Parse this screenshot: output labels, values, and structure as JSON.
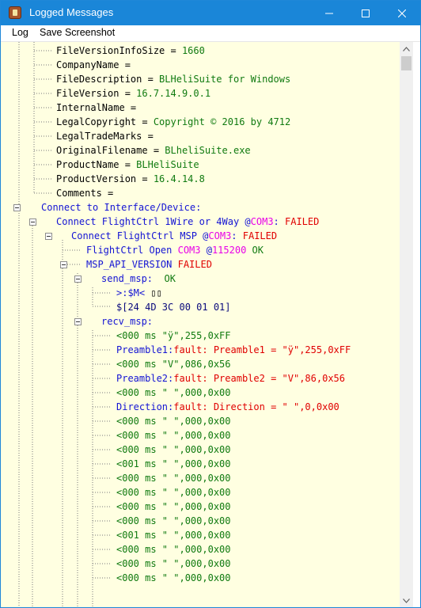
{
  "window": {
    "title": "Logged Messages"
  },
  "icons": {
    "app": "app-icon",
    "minimize": "minimize-icon",
    "maximize": "maximize-icon",
    "close": "close-icon",
    "expand": "expander-minus-icon"
  },
  "menu": {
    "log": "Log",
    "save": "Save Screenshot"
  },
  "colors": {
    "titlebar": "#1a86d8",
    "background": "#ffffe1",
    "key_text": "#000000",
    "value_text": "#107a10",
    "heading_text": "#1414d4",
    "failed_text": "#e00000",
    "port_text": "#e800e8"
  },
  "log": {
    "l0": [
      "FileVersionInfoSize = ",
      "1660"
    ],
    "l1": [
      "CompanyName ="
    ],
    "l2": [
      "FileDescription = ",
      "BLHeliSuite for Windows"
    ],
    "l3": [
      "FileVersion = ",
      "16.7.14.9.0.1"
    ],
    "l4": [
      "InternalName ="
    ],
    "l5": [
      "LegalCopyright = ",
      "Copyright © 2016 by 4712"
    ],
    "l6": [
      "LegalTradeMarks ="
    ],
    "l7": [
      "OriginalFilename = ",
      "BLheliSuite.exe"
    ],
    "l8": [
      "ProductName = ",
      "BLHeliSuite"
    ],
    "l9": [
      "ProductVersion = ",
      "16.4.14.8"
    ],
    "l10": [
      "Comments ="
    ],
    "l11": [
      "Connect to Interface/Device:"
    ],
    "l12": [
      "Connect FlightCtrl 1Wire or 4Way @",
      "COM3",
      ": ",
      "FAILED"
    ],
    "l13": [
      "Connect FlightCtrl MSP @",
      "COM3",
      ": ",
      "FAILED"
    ],
    "l14": [
      "FlightCtrl Open ",
      "COM3",
      " @",
      "115200",
      " OK"
    ],
    "l15": [
      "MSP_API_VERSION ",
      "FAILED"
    ],
    "l16": [
      "send_msp:  ",
      "OK"
    ],
    "l17": [
      ">:$M<",
      " ▯▯"
    ],
    "l18": [
      "$[24 4D 3C 00 01 01]"
    ],
    "l19": [
      "recv_msp:"
    ],
    "l20": [
      "<000 ms \"ÿ\",255,0xFF"
    ],
    "l21": [
      "Preamble1:",
      "fault: Preamble1 = \"ÿ\",255,0xFF"
    ],
    "l22": [
      "<000 ms \"V\",086,0x56"
    ],
    "l23": [
      "Preamble2:",
      "fault: Preamble2 = \"V\",86,0x56"
    ],
    "l24": [
      "<000 ms \" \",000,0x00"
    ],
    "l25": [
      "Direction:",
      "fault: Direction = \" \",0,0x00"
    ],
    "l26": [
      "<000 ms \" \",000,0x00"
    ],
    "l27": [
      "<000 ms \" \",000,0x00"
    ],
    "l28": [
      "<000 ms \" \",000,0x00"
    ],
    "l29": [
      "<001 ms \" \",000,0x00"
    ],
    "l30": [
      "<000 ms \" \",000,0x00"
    ],
    "l31": [
      "<000 ms \" \",000,0x00"
    ],
    "l32": [
      "<000 ms \" \",000,0x00"
    ],
    "l33": [
      "<000 ms \" \",000,0x00"
    ],
    "l34": [
      "<001 ms \" \",000,0x00"
    ],
    "l35": [
      "<000 ms \" \",000,0x00"
    ],
    "l36": [
      "<000 ms \" \",000,0x00"
    ],
    "l37": [
      "<000 ms \" \",000,0x00"
    ]
  }
}
